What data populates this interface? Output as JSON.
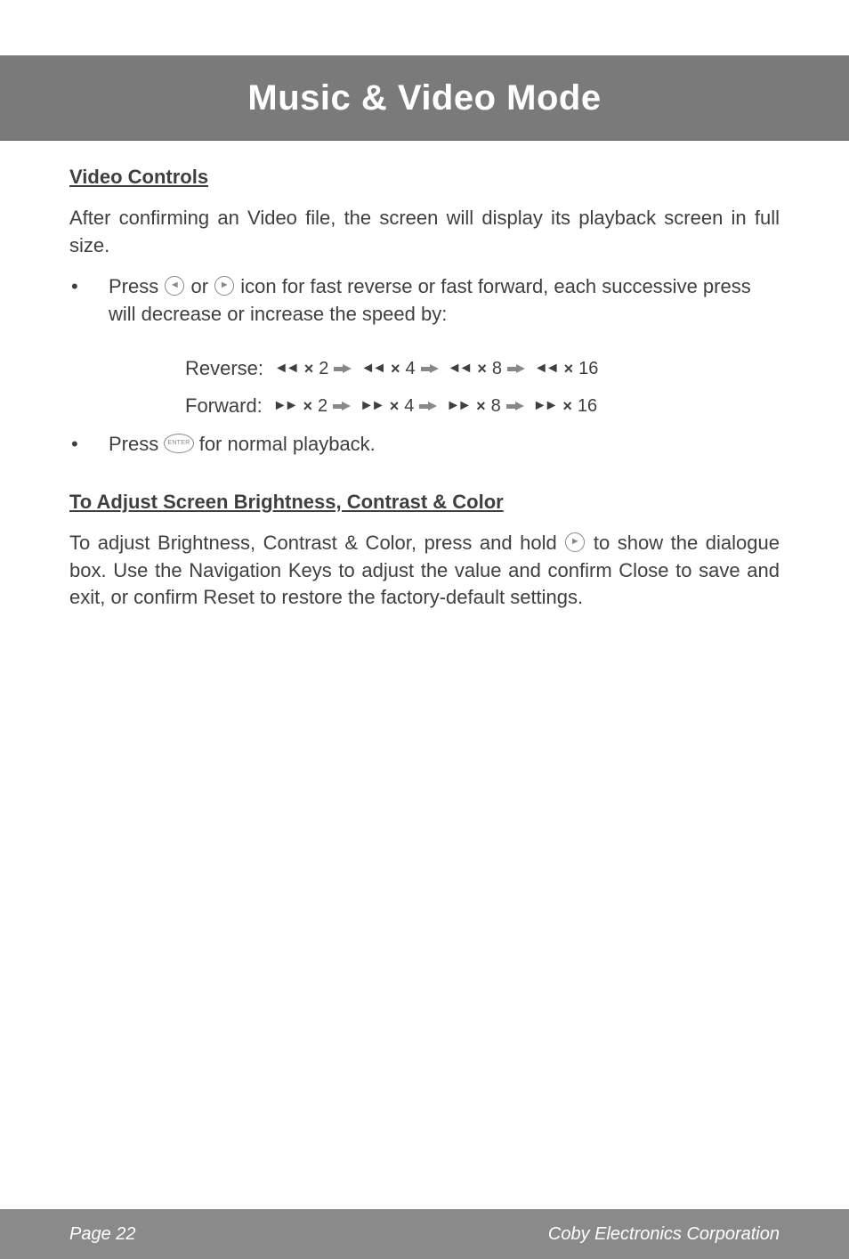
{
  "header": {
    "title": "Music & Video Mode"
  },
  "section1": {
    "heading": "Video Controls",
    "intro": "After confirming an Video file, the screen will display its playback screen in full size.",
    "bullet1_a": "Press ",
    "bullet1_b": " or ",
    "bullet1_c": " icon for fast reverse or fast forward, each successive press will decrease or increase the speed by:",
    "reverse_label": "Reverse:",
    "forward_label": "Forward:",
    "speeds": [
      "2",
      "4",
      "8",
      "16"
    ],
    "bullet2_a": "Press ",
    "bullet2_b": " for normal playback."
  },
  "section2": {
    "heading": "To Adjust Screen Brightness, Contrast & Color",
    "text_a": "To adjust Brightness, Contrast & Color, press and hold ",
    "text_b": " to show the dialogue box. Use the Navigation Keys to adjust the value and confirm Close to save and exit, or confirm Reset to restore the factory-default settings."
  },
  "icons": {
    "left": "◄",
    "right": "►",
    "enter": "ENTER",
    "rewind": "◄◄",
    "fastfwd": "►►"
  },
  "footer": {
    "page": "Page 22",
    "company": "Coby Electronics Corporation"
  }
}
